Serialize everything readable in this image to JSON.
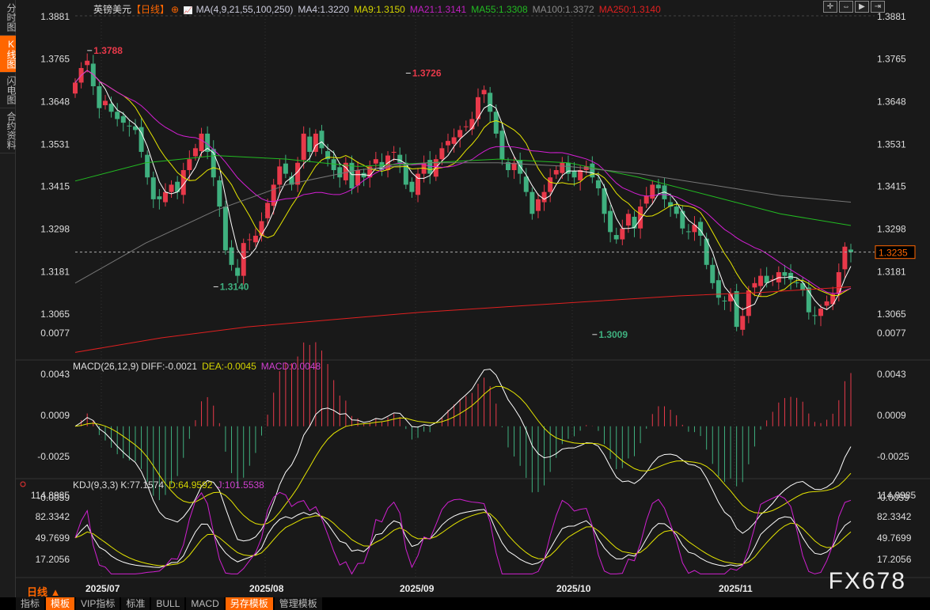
{
  "sidebar": {
    "tabs": [
      {
        "label": "分时图",
        "active": false
      },
      {
        "label": "K线图",
        "active": true
      },
      {
        "label": "闪电图",
        "active": false
      },
      {
        "label": "合约资料",
        "active": false
      }
    ]
  },
  "header": {
    "symbol": "英镑美元",
    "period": "【日线】",
    "ma_label": "MA(4,9,21,55,100,250)",
    "ma4": "MA4:1.3220",
    "ma9": "MA9:1.3150",
    "ma21": "MA21:1.3141",
    "ma55": "MA55:1.3308",
    "ma100": "MA100:1.3372",
    "ma250": "MA250:1.3140"
  },
  "tools": [
    "crosshair-icon",
    "zoom-in-icon",
    "play-icon",
    "move-right-icon"
  ],
  "macd_legend": {
    "title": "MACD(26,12,9)",
    "diff": "DIFF:-0.0021",
    "dea": "DEA:-0.0045",
    "macd": "MACD:0.0048"
  },
  "kdj_legend": {
    "title": "KDJ(9,3,3)",
    "k": "K:77.1574",
    "d": "D:64.9592",
    "j": "J:101.5538"
  },
  "period_label": "日线 ▲",
  "watermark": "FX678",
  "toolbar": [
    {
      "label": "指标",
      "active": false
    },
    {
      "label": "模板",
      "active": true
    },
    {
      "label": "VIP指标",
      "active": false
    },
    {
      "label": "标准",
      "active": false
    },
    {
      "label": "BULL",
      "active": false
    },
    {
      "label": "MACD",
      "active": false
    },
    {
      "label": "另存模板",
      "active": true
    },
    {
      "label": "管理模板",
      "active": false
    }
  ],
  "colors": {
    "up": "#e8394a",
    "down": "#3fb07f",
    "ma4": "#ffffff",
    "ma9": "#e6e600",
    "ma21": "#d51fd5",
    "ma55": "#22bb22",
    "ma100": "#777777",
    "ma250": "#e02020",
    "accent": "#ff6600"
  },
  "chart_data": [
    {
      "type": "candlestick",
      "title": "英镑美元",
      "yticks": [
        "1.3881",
        "1.3765",
        "1.3648",
        "1.3531",
        "1.3415",
        "1.3298",
        "1.3181",
        "1.3065"
      ],
      "ylim": [
        1.293,
        1.3881
      ],
      "xticks": [
        "2025/07",
        "2025/08",
        "2025/09",
        "2025/10",
        "2025/11"
      ],
      "current_price": "1.3235",
      "annotations": [
        {
          "label": "1.3788",
          "value": 1.3788,
          "index": 2
        },
        {
          "label": "1.3726",
          "value": 1.3726,
          "index": 55
        },
        {
          "label": "1.3140",
          "value": 1.314,
          "index": 23
        },
        {
          "label": "1.3009",
          "value": 1.3009,
          "index": 86
        }
      ],
      "close": [
        1.37,
        1.374,
        1.376,
        1.369,
        1.363,
        1.365,
        1.362,
        1.36,
        1.359,
        1.358,
        1.357,
        1.351,
        1.344,
        1.338,
        1.338,
        1.34,
        1.342,
        1.34,
        1.346,
        1.349,
        1.352,
        1.356,
        1.351,
        1.344,
        1.336,
        1.324,
        1.32,
        1.317,
        1.326,
        1.327,
        1.328,
        1.332,
        1.337,
        1.342,
        1.347,
        1.345,
        1.342,
        1.348,
        1.356,
        1.351,
        1.356,
        1.352,
        1.349,
        1.346,
        1.344,
        1.348,
        1.341,
        1.346,
        1.344,
        1.347,
        1.349,
        1.346,
        1.35,
        1.351,
        1.348,
        1.342,
        1.34,
        1.345,
        1.348,
        1.345,
        1.349,
        1.352,
        1.354,
        1.355,
        1.357,
        1.358,
        1.36,
        1.366,
        1.368,
        1.362,
        1.356,
        1.349,
        1.346,
        1.348,
        1.345,
        1.34,
        1.334,
        1.338,
        1.34,
        1.344,
        1.346,
        1.348,
        1.345,
        1.344,
        1.346,
        1.347,
        1.344,
        1.341,
        1.334,
        1.329,
        1.327,
        1.33,
        1.334,
        1.33,
        1.336,
        1.339,
        1.342,
        1.341,
        1.338,
        1.336,
        1.334,
        1.33,
        1.329,
        1.331,
        1.328,
        1.32,
        1.315,
        1.311,
        1.31,
        1.312,
        1.303,
        1.306,
        1.313,
        1.315,
        1.317,
        1.315,
        1.316,
        1.318,
        1.317,
        1.316,
        1.315,
        1.313,
        1.307,
        1.306,
        1.308,
        1.31,
        1.312,
        1.318,
        1.325,
        1.3235
      ],
      "ma100": [
        1.315,
        1.326,
        1.335,
        1.342,
        1.346,
        1.348,
        1.348,
        1.347,
        1.345,
        1.342,
        1.339,
        1.3372
      ],
      "ma250": [
        1.296,
        1.3,
        1.303,
        1.305,
        1.307,
        1.3085,
        1.31,
        1.3115,
        1.3125,
        1.314
      ],
      "ma55": [
        1.343,
        1.348,
        1.35,
        1.349,
        1.347,
        1.348,
        1.349,
        1.348,
        1.344,
        1.339,
        1.334,
        1.3308
      ]
    },
    {
      "type": "macd",
      "yticks": [
        "0.0077",
        "0.0043",
        "0.0009",
        "-0.0025",
        "-0.0059"
      ],
      "ylim": [
        -0.0085,
        0.0085
      ]
    },
    {
      "type": "kdj",
      "yticks": [
        "114.8985",
        "82.3342",
        "49.7699",
        "17.2056"
      ],
      "ylim": [
        -5,
        125
      ]
    }
  ]
}
